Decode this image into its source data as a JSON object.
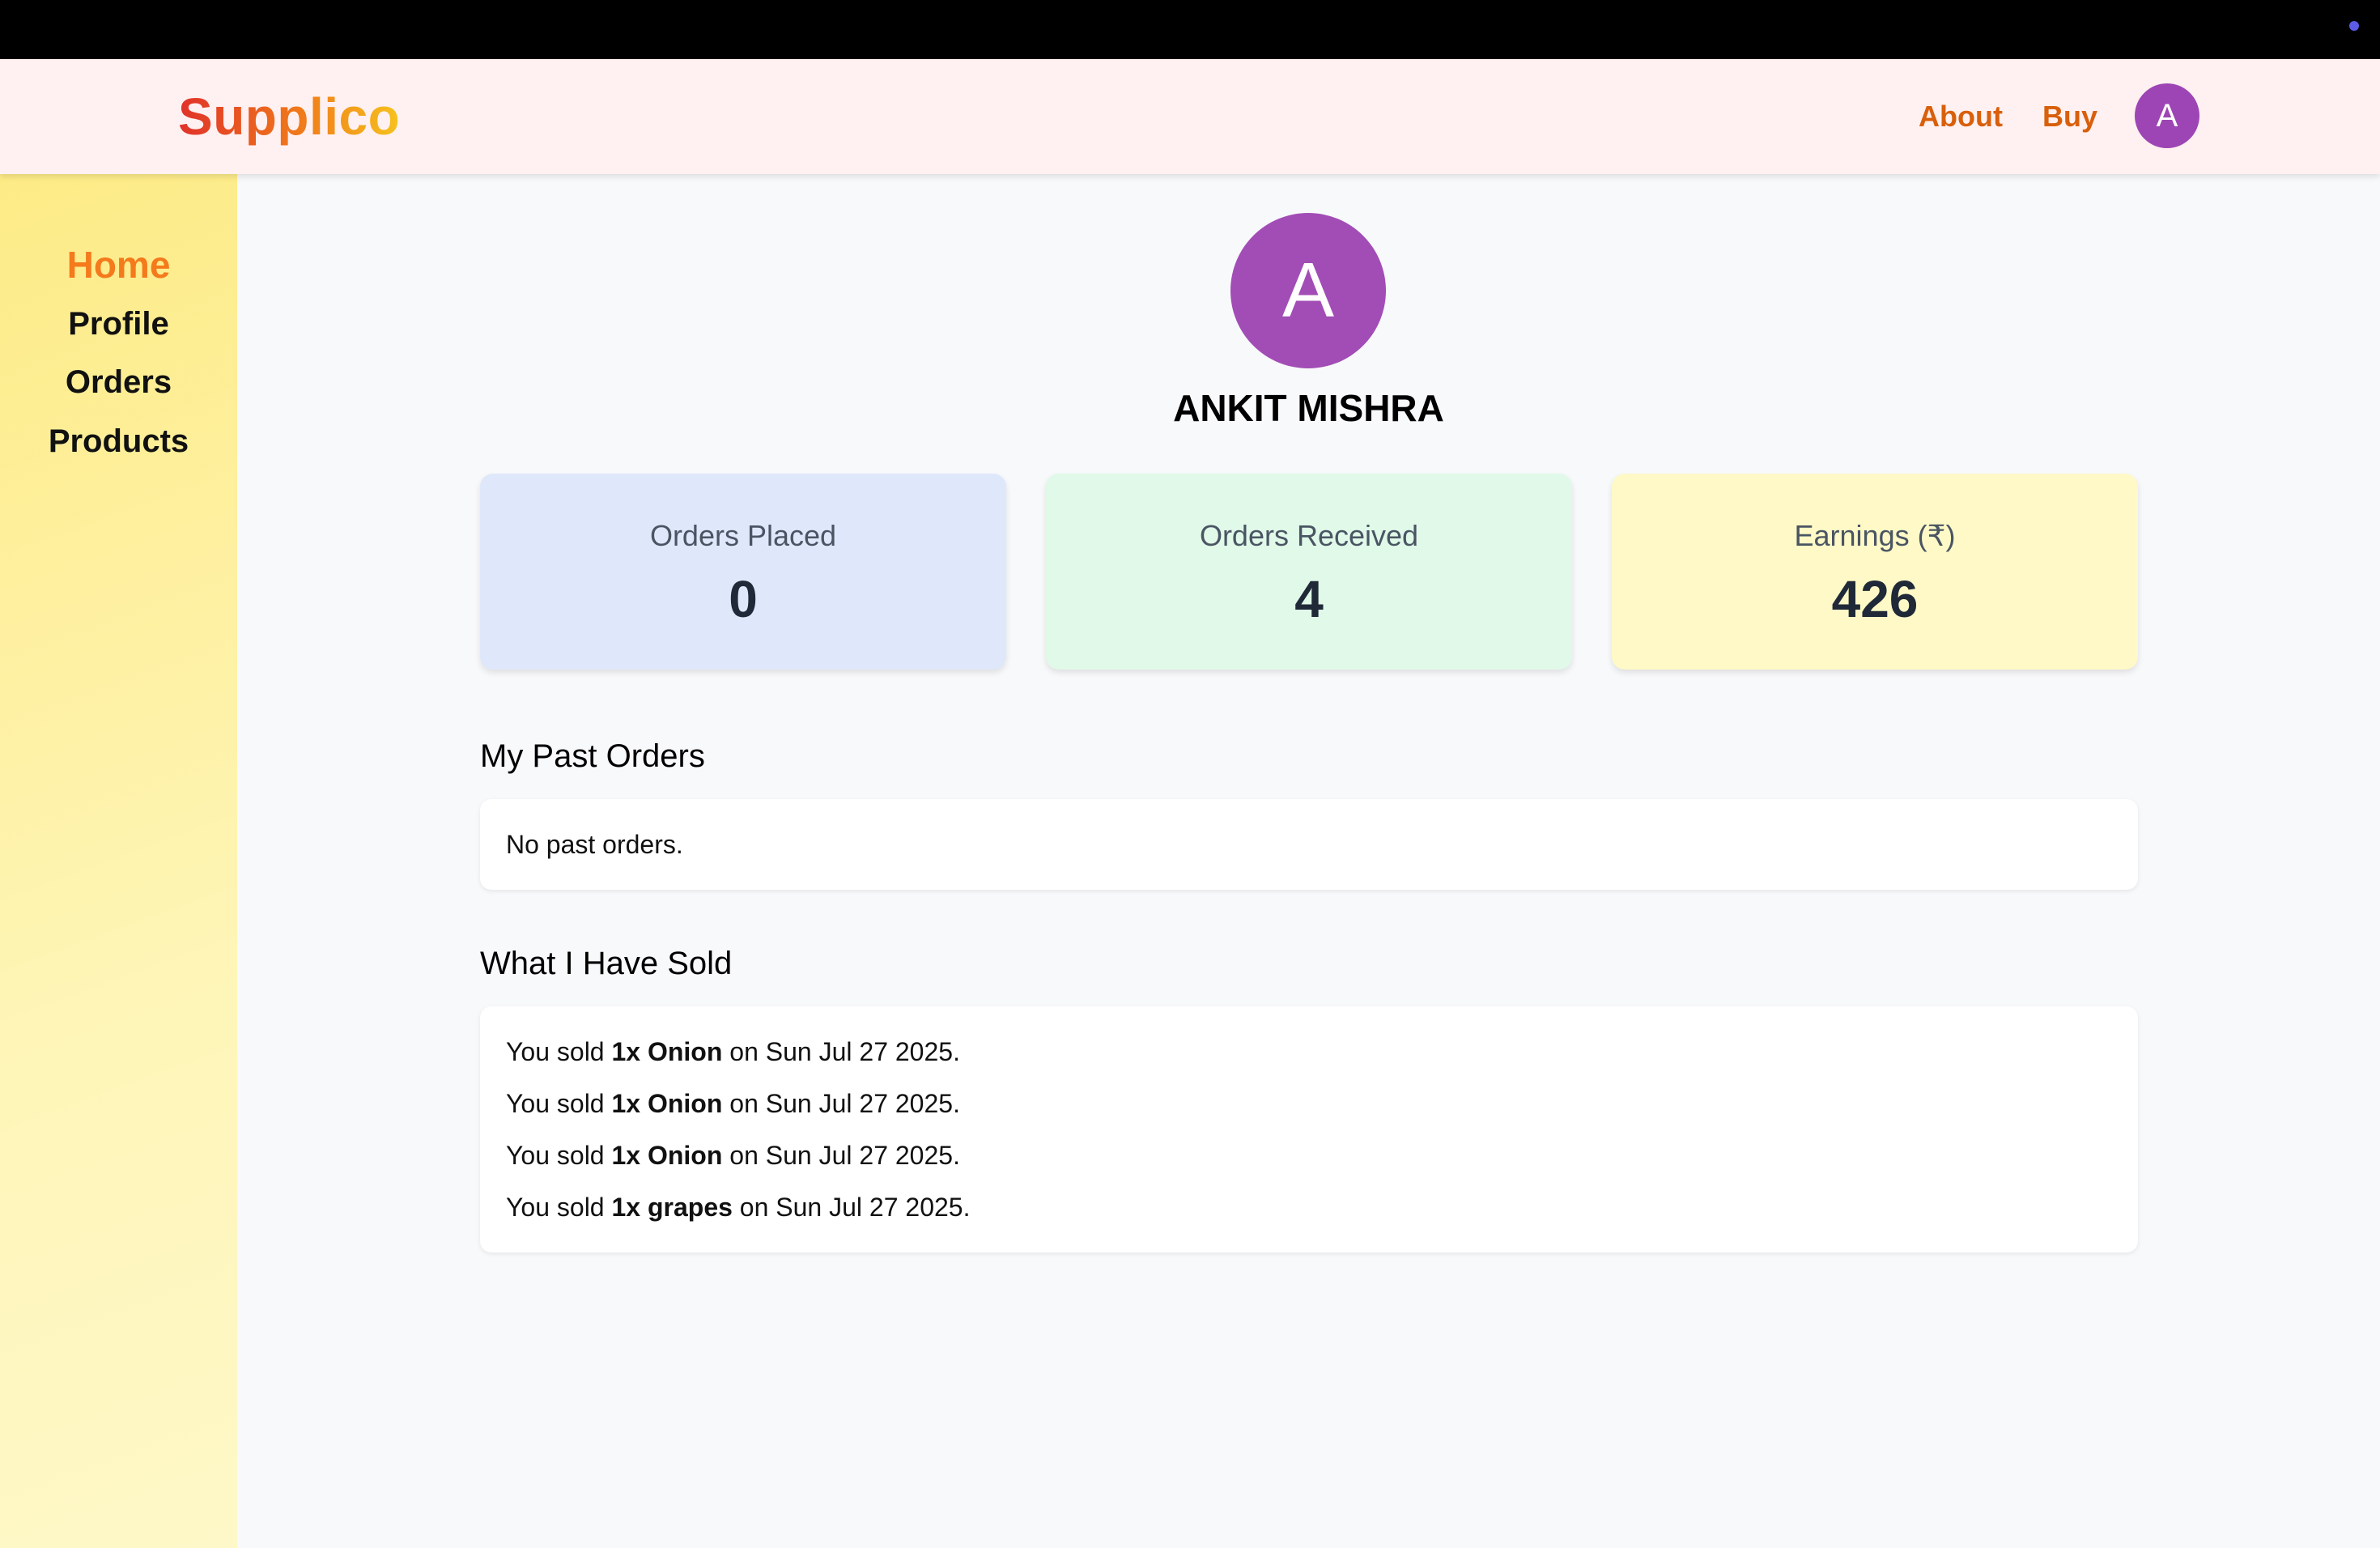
{
  "brand": {
    "name": "Supplico"
  },
  "nav": {
    "about": "About",
    "buy": "Buy",
    "avatar_initial": "A"
  },
  "sidebar": {
    "items": [
      {
        "label": "Home",
        "active": true
      },
      {
        "label": "Profile",
        "active": false
      },
      {
        "label": "Orders",
        "active": false
      },
      {
        "label": "Products",
        "active": false
      }
    ]
  },
  "profile": {
    "initial": "A",
    "name": "ANKIT MISHRA"
  },
  "stats": [
    {
      "label": "Orders Placed",
      "value": "0"
    },
    {
      "label": "Orders Received",
      "value": "4"
    },
    {
      "label": "Earnings (₹)",
      "value": "426"
    }
  ],
  "past_orders": {
    "title": "My Past Orders",
    "empty_text": "No past orders."
  },
  "sold": {
    "title": "What I Have Sold",
    "items": [
      {
        "prefix": "You sold ",
        "item": "1x Onion",
        "suffix": " on Sun Jul 27 2025."
      },
      {
        "prefix": "You sold ",
        "item": "1x Onion",
        "suffix": " on Sun Jul 27 2025."
      },
      {
        "prefix": "You sold ",
        "item": "1x Onion",
        "suffix": " on Sun Jul 27 2025."
      },
      {
        "prefix": "You sold ",
        "item": "1x grapes",
        "suffix": " on Sun Jul 27 2025."
      }
    ]
  },
  "colors": {
    "accent": "#d95f0b",
    "avatar": "#9d45b4",
    "sidebar_active": "#f47a1c"
  }
}
